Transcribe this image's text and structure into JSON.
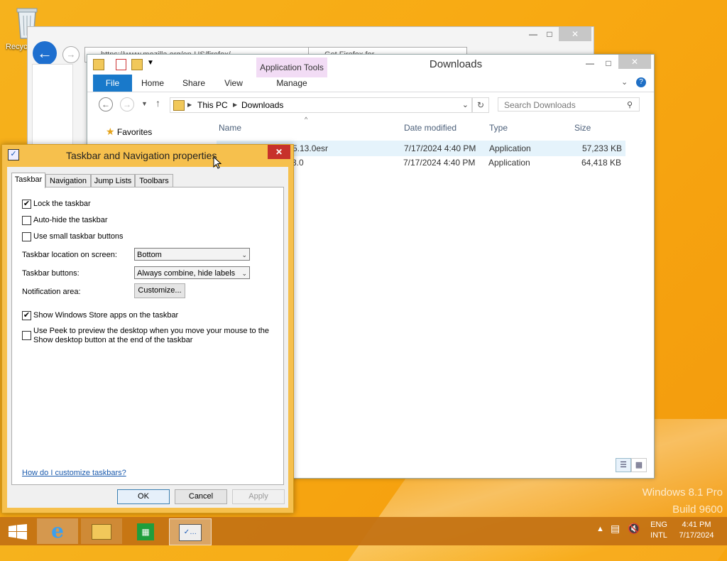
{
  "desktop": {
    "recycle_label": "Recyc",
    "watermark_line1": "Windows 8.1 Pro",
    "watermark_line2": "Build 9600"
  },
  "browser": {
    "address_text": "https://www.mozilla.org/en-US/firefox/",
    "tab_text": "Get Firefox for ..."
  },
  "explorer": {
    "title": "Downloads",
    "app_tools": "Application Tools",
    "tabs": {
      "file": "File",
      "home": "Home",
      "share": "Share",
      "view": "View",
      "manage": "Manage"
    },
    "path": {
      "root": "This PC",
      "folder": "Downloads"
    },
    "search_placeholder": "Search Downloads",
    "favorites": "Favorites",
    "columns": {
      "name": "Name",
      "date": "Date modified",
      "type": "Type",
      "size": "Size"
    },
    "files": [
      {
        "name": "5.13.0esr",
        "date": "7/17/2024 4:40 PM",
        "type": "Application",
        "size": "57,233 KB"
      },
      {
        "name": "3.0",
        "date": "7/17/2024 4:40 PM",
        "type": "Application",
        "size": "64,418 KB"
      }
    ]
  },
  "dialog": {
    "title": "Taskbar and Navigation properties",
    "tabs": [
      "Taskbar",
      "Navigation",
      "Jump Lists",
      "Toolbars"
    ],
    "lock_taskbar": "Lock the taskbar",
    "auto_hide": "Auto-hide the taskbar",
    "small_buttons": "Use small taskbar buttons",
    "location_label": "Taskbar location on screen:",
    "location_value": "Bottom",
    "buttons_label": "Taskbar buttons:",
    "buttons_value": "Always combine, hide labels",
    "notification_label": "Notification area:",
    "customize_button": "Customize...",
    "store_apps": "Show Windows Store apps on the taskbar",
    "peek_line1": "Use Peek to preview the desktop when you move your mouse to the",
    "peek_line2": "Show desktop button at the end of the taskbar",
    "help_link": "How do I customize taskbars?",
    "ok": "OK",
    "cancel": "Cancel",
    "apply": "Apply"
  },
  "taskbar": {
    "lang_top": "ENG",
    "lang_bottom": "INTL",
    "time": "4:41 PM",
    "date": "7/17/2024"
  }
}
